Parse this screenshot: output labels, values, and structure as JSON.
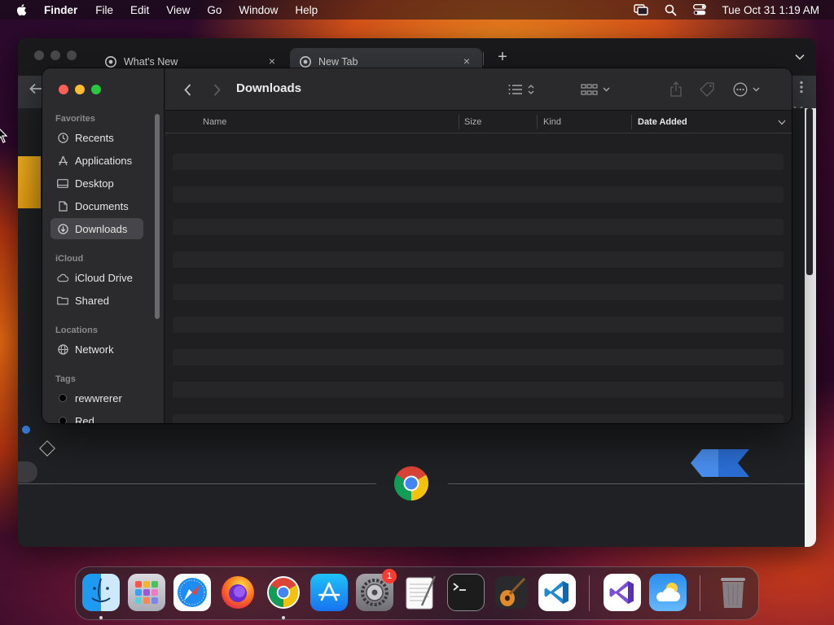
{
  "menubar": {
    "app_name": "Finder",
    "items": [
      "File",
      "Edit",
      "View",
      "Go",
      "Window",
      "Help"
    ],
    "clock": "Tue Oct 31  1:19 AM"
  },
  "chrome": {
    "tabs": [
      {
        "label": "What's New"
      },
      {
        "label": "New Tab"
      }
    ],
    "new_tab_symbol": "+",
    "close_symbol": "×"
  },
  "finder": {
    "title": "Downloads",
    "sidebar": {
      "favorites_title": "Favorites",
      "favorites": [
        {
          "label": "Recents",
          "icon": "clock-icon"
        },
        {
          "label": "Applications",
          "icon": "applications-icon"
        },
        {
          "label": "Desktop",
          "icon": "desktop-icon"
        },
        {
          "label": "Documents",
          "icon": "document-icon"
        },
        {
          "label": "Downloads",
          "icon": "download-icon",
          "selected": true
        }
      ],
      "icloud_title": "iCloud",
      "icloud": [
        {
          "label": "iCloud Drive",
          "icon": "cloud-icon"
        },
        {
          "label": "Shared",
          "icon": "shared-folder-icon"
        }
      ],
      "locations_title": "Locations",
      "locations": [
        {
          "label": "Network",
          "icon": "globe-icon"
        }
      ],
      "tags_title": "Tags",
      "tags": [
        {
          "label": "rewwrerer",
          "color": "#000000"
        },
        {
          "label": "Red",
          "color": "#000000"
        }
      ]
    },
    "columns": {
      "name": "Name",
      "size": "Size",
      "kind": "Kind",
      "date_added": "Date Added"
    }
  },
  "dock": {
    "apps": [
      {
        "name": "Finder",
        "running": true
      },
      {
        "name": "Launchpad"
      },
      {
        "name": "Safari"
      },
      {
        "name": "Firefox"
      },
      {
        "name": "Google Chrome",
        "running": true
      },
      {
        "name": "App Store"
      },
      {
        "name": "System Settings",
        "badge": "1"
      },
      {
        "name": "TextEdit"
      },
      {
        "name": "Terminal"
      },
      {
        "name": "GarageBand"
      },
      {
        "name": "Visual Studio Code"
      },
      {
        "name": "Visual Studio"
      },
      {
        "name": "Weather"
      },
      {
        "name": "Trash"
      }
    ]
  },
  "colors": {
    "traffic_red": "#ff5f57",
    "traffic_yellow": "#febc2e",
    "traffic_green": "#28c840",
    "finder_bg": "#1f1f21",
    "sidebar_bg": "#2b2b2e",
    "selection": "#46464a",
    "badge": "#ff3b30"
  }
}
